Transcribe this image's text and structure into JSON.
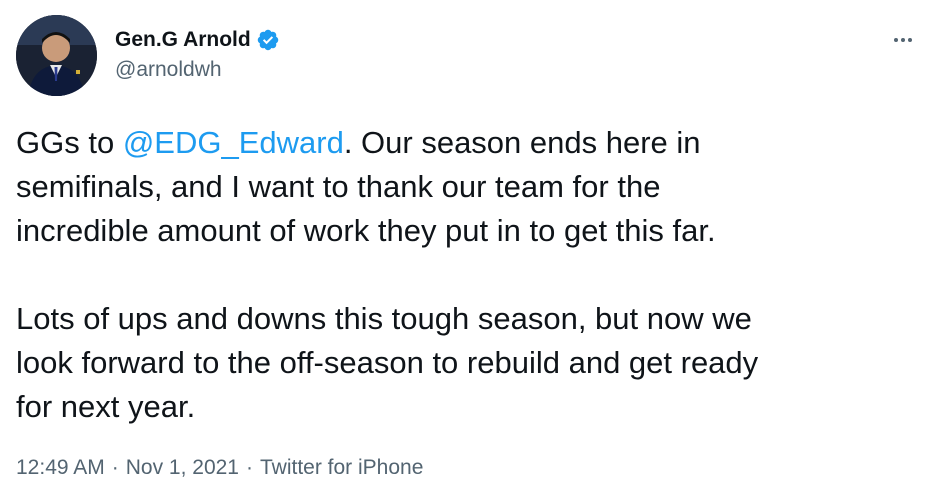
{
  "author": {
    "display_name": "Gen.G Arnold",
    "handle": "@arnoldwh",
    "verified": true
  },
  "tweet": {
    "line1_prefix": "GGs to ",
    "mention": "@EDG_Edward",
    "line1_suffix": ". Our season ends here in\nsemifinals, and I want to thank our team for the\nincredible amount of work they put in to get this far.\n\nLots of ups and downs this tough season, but now we\nlook forward to the off-season to rebuild and get ready\nfor next year."
  },
  "meta": {
    "time": "12:49 AM",
    "date": "Nov 1, 2021",
    "source": "Twitter for iPhone",
    "separator": "·"
  },
  "icons": {
    "verified": "verified-badge-icon",
    "more": "more-horizontal-icon"
  },
  "colors": {
    "accent": "#1d9bf0",
    "text": "#0f1419",
    "secondary": "#536471"
  }
}
